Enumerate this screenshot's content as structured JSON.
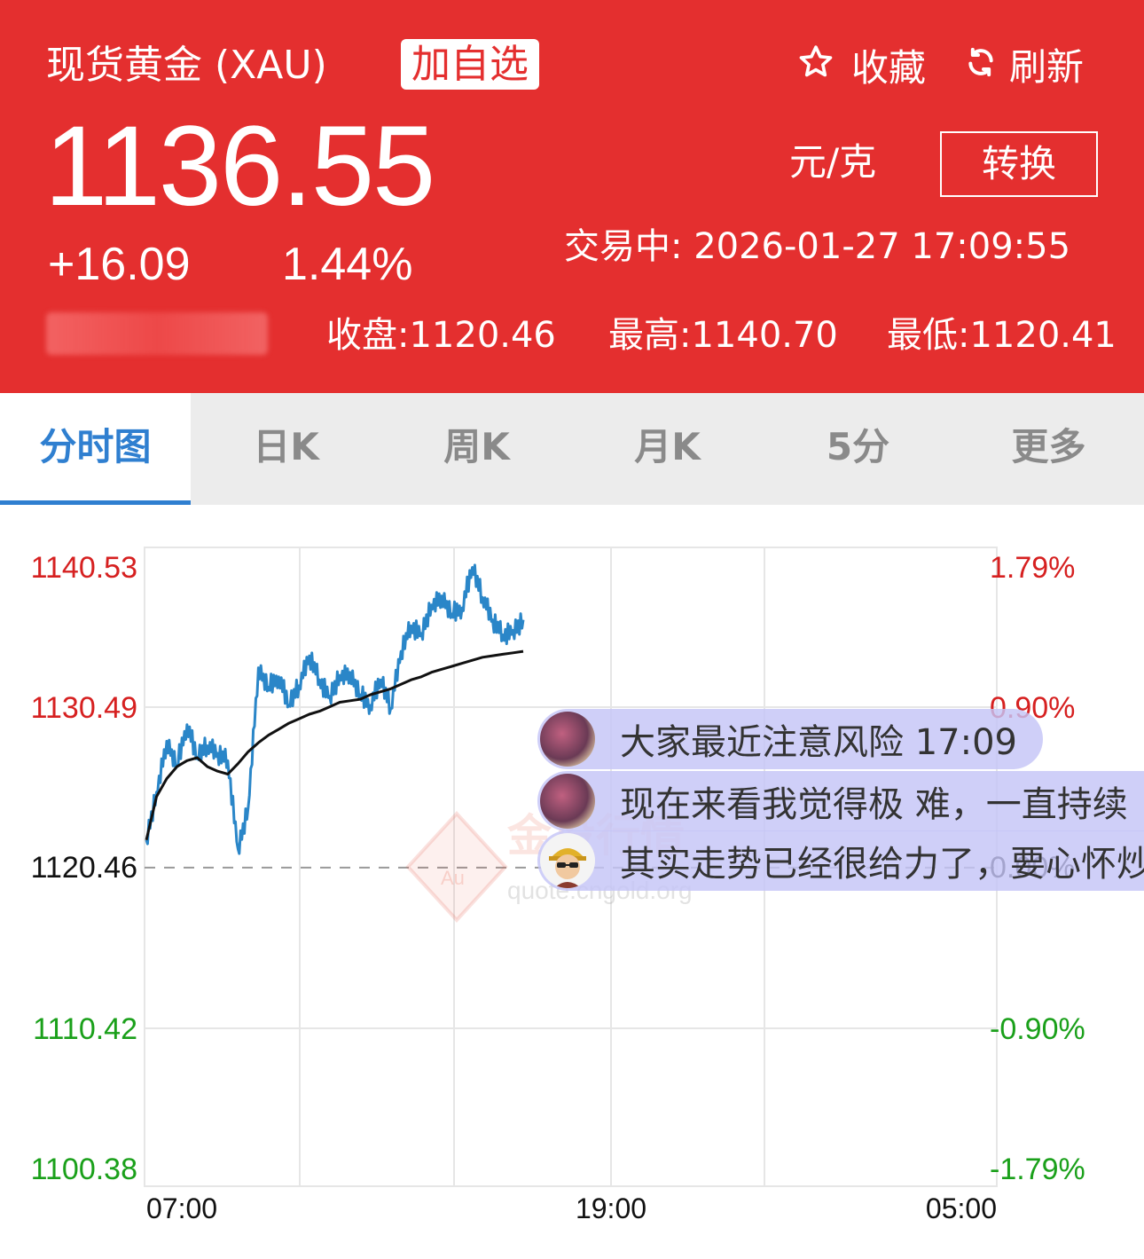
{
  "header": {
    "title": "现货黄金 (XAU)",
    "add_watch_label": "加自选",
    "favorite_label": "收藏",
    "refresh_label": "刷新",
    "price": "1136.55",
    "unit": "元/克",
    "convert_label": "转换",
    "change": "+16.09",
    "change_pct": "1.44%",
    "status": "交易中:  2026-01-27 17:09:55",
    "close": "收盘:1120.46",
    "high": "最高:1140.70",
    "low": "最低:1120.41",
    "bg_color": "#e42f2f"
  },
  "tabs": [
    {
      "label": "分时图",
      "active": true
    },
    {
      "label": "日K",
      "active": false
    },
    {
      "label": "周K",
      "active": false
    },
    {
      "label": "月K",
      "active": false
    },
    {
      "label": "5分",
      "active": false
    },
    {
      "label": "更多",
      "active": false
    }
  ],
  "chart_data": {
    "type": "line",
    "y_left_ticks": [
      "1140.53",
      "1130.49",
      "1120.46",
      "1110.42",
      "1100.38"
    ],
    "y_right_ticks": [
      "1.79%",
      "0.90%",
      "0.00%",
      "-0.90%",
      "-1.79%"
    ],
    "x_ticks": [
      "07:00",
      "19:00",
      "05:00"
    ],
    "ylim": [
      1100.38,
      1140.53
    ],
    "reference_close": 1120.46,
    "series": [
      {
        "color": "#2a86c8",
        "values": [
          1122.3,
          1125.5,
          1128.9,
          1127.3,
          1130.0,
          1127.8,
          1128.6,
          1128.1,
          1127.6,
          1121.7,
          1124.5,
          1133.8,
          1132.5,
          1133.2,
          1131.3,
          1132.6,
          1134.6,
          1133.0,
          1131.9,
          1133.3,
          1133.5,
          1132.0,
          1131.3,
          1133.0,
          1131.1,
          1134.9,
          1136.6,
          1136.1,
          1138.0,
          1138.6,
          1137.4,
          1137.8,
          1140.5,
          1138.5,
          1137.0,
          1136.0,
          1136.3,
          1137.0
        ]
      },
      {
        "color": "#111111",
        "values": [
          1122.3,
          1125.2,
          1126.4,
          1127.2,
          1127.6,
          1127.8,
          1127.2,
          1126.9,
          1126.7,
          1127.4,
          1128.2,
          1128.8,
          1129.3,
          1129.7,
          1130.1,
          1130.4,
          1130.7,
          1130.9,
          1131.2,
          1131.5,
          1131.6,
          1131.7,
          1132.0,
          1132.2,
          1132.4,
          1132.7,
          1133.0,
          1133.2,
          1133.5,
          1133.7,
          1133.9,
          1134.1,
          1134.3,
          1134.5,
          1134.6,
          1134.7,
          1134.8,
          1134.9
        ]
      }
    ]
  },
  "watermark": {
    "brand": "金投行情",
    "logo_text": "Au",
    "url": "quote.cngold.org"
  },
  "chat": [
    {
      "text": "大家最近注意风险 17:09"
    },
    {
      "text": "现在来看我觉得极 难，一直持续"
    },
    {
      "text": "其实走势已经很给力了，要心怀炒"
    }
  ]
}
